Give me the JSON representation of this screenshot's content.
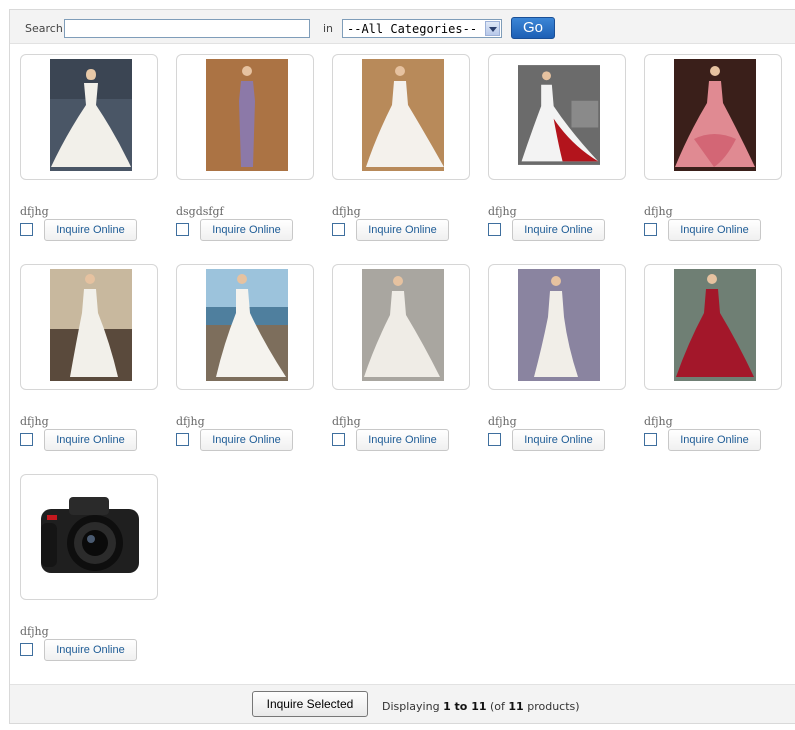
{
  "search": {
    "label": "Search:",
    "query": "",
    "in_label": "in",
    "category_selected": "--All Categories--",
    "go_label": "Go"
  },
  "products": [
    {
      "name": "dfjhg",
      "button": "Inquire Online",
      "image": "wedding-dress-strapless-ballgown"
    },
    {
      "name": "dsgdsfgf",
      "button": "Inquire Online",
      "image": "purple-bridesmaid-dress"
    },
    {
      "name": "dfjhg",
      "button": "Inquire Online",
      "image": "wedding-dress-ruffled"
    },
    {
      "name": "dfjhg",
      "button": "Inquire Online",
      "image": "red-white-wedding-gown"
    },
    {
      "name": "dfjhg",
      "button": "Inquire Online",
      "image": "pink-ballgown"
    },
    {
      "name": "dfjhg",
      "button": "Inquire Online",
      "image": "beach-wedding-dress"
    },
    {
      "name": "dfjhg",
      "button": "Inquire Online",
      "image": "seaside-wedding-dress"
    },
    {
      "name": "dfjhg",
      "button": "Inquire Online",
      "image": "pickup-ballgown"
    },
    {
      "name": "dfjhg",
      "button": "Inquire Online",
      "image": "lace-mermaid-dress"
    },
    {
      "name": "dfjhg",
      "button": "Inquire Online",
      "image": "red-ballgown"
    },
    {
      "name": "dfjhg",
      "button": "Inquire Online",
      "image": "nikon-dslr-camera"
    }
  ],
  "footer": {
    "inquire_selected": "Inquire Selected",
    "displaying_prefix": "Displaying",
    "range": "1 to 11",
    "of_open": "(of",
    "total": "11",
    "suffix": "products)"
  }
}
